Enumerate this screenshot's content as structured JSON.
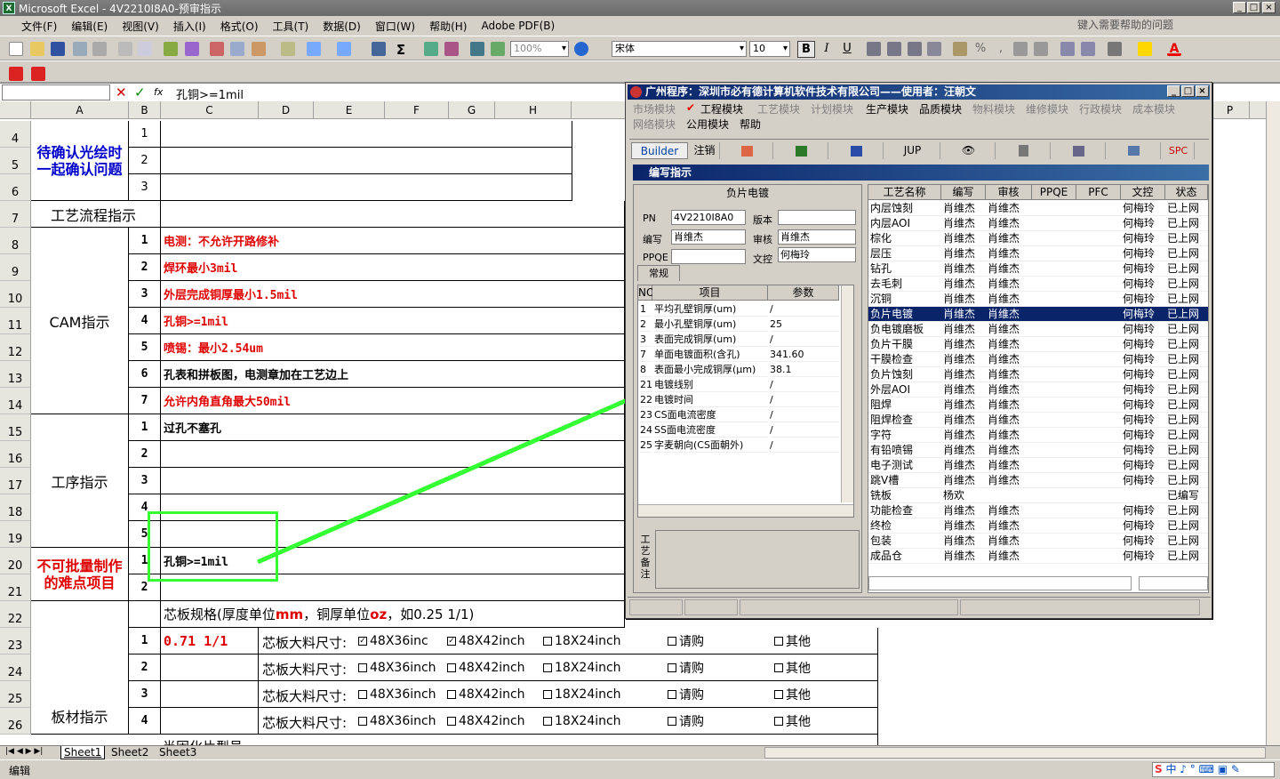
{
  "app": {
    "title": "Microsoft Excel - 4V2210I8A0-预审指示",
    "help_placeholder": "键入需要帮助的问题",
    "controls": {
      "min": "_",
      "max": "□",
      "close": "×"
    }
  },
  "menu": [
    "文件(F)",
    "编辑(E)",
    "视图(V)",
    "插入(I)",
    "格式(O)",
    "工具(T)",
    "数据(D)",
    "窗口(W)",
    "帮助(H)",
    "Adobe PDF(B)"
  ],
  "toolbar": {
    "zoom": "100%",
    "font": "宋体",
    "size": "10",
    "bold": "B",
    "italic": "I",
    "underline": "U",
    "pct": "%",
    "comma": ","
  },
  "formula": {
    "fx": "fx",
    "content": "孔铜>=1mil"
  },
  "columns": [
    "A",
    "B",
    "C",
    "D",
    "E",
    "F",
    "G",
    "H",
    "P"
  ],
  "rows": [
    "4",
    "5",
    "6",
    "7",
    "8",
    "9",
    "10",
    "11",
    "12",
    "13",
    "14",
    "15",
    "16",
    "17",
    "18",
    "19",
    "20",
    "21",
    "22",
    "23",
    "24",
    "25",
    "26"
  ],
  "sheet": {
    "confirm": "待确认光绘时一起确认问题",
    "process": "工艺流程指示",
    "cam": "CAM指示",
    "op": "工序指示",
    "hard": "不可批量制作的难点项目",
    "board": "板材指示",
    "nums": {
      "n1": "1",
      "n2": "2",
      "n3": "3",
      "n4": "4",
      "n5": "5",
      "n6": "6",
      "n7": "7"
    },
    "cam_items": [
      "电测：不允许开路修补",
      "焊环最小3mil",
      "外层完成铜厚最小1.5mil",
      "孔铜>=1mil",
      "喷锡：最小2.54um",
      "孔表和拼板图，电测章加在工艺边上",
      "允许内角直角最大50mil"
    ],
    "op1": "过孔不塞孔",
    "hard1": "孔铜>=1mil",
    "core_title_a": "芯板规格(厚度单位",
    "core_title_mm": "mm",
    "core_title_b": "，铜厚单位",
    "core_title_oz": "oz",
    "core_title_c": "，如0.25 1/1)",
    "core_val": "0.71 1/1",
    "core_size": "芯板大料尺寸:",
    "opts": [
      "48X36inch",
      "48X42inch",
      "18X24inch",
      "请购",
      "其他"
    ],
    "opts_first": "48X36inc",
    "row27": "半固化片型号"
  },
  "tabs": [
    "Sheet1",
    "Sheet2",
    "Sheet3"
  ],
  "status": "编辑",
  "popup": {
    "title": "广州程序：深圳市必有德计算机软件技术有限公司——使用者：汪朝文",
    "menu1": [
      "市场模块",
      "工程模块",
      "工艺模块",
      "计划模块",
      "生产模块",
      "品质模块",
      "物料模块",
      "维修模块",
      "行政模块",
      "成本模块"
    ],
    "menu2": [
      "网络模块",
      "公用模块",
      "帮助"
    ],
    "tools": {
      "builder": "Builder",
      "logout": "注销",
      "jup": "JUP",
      "spc": "SPC"
    },
    "subtitle": "编写指示",
    "panel": "负片电镀",
    "pn_label": "PN",
    "pn": "4V2210I8A0",
    "ver_label": "版本",
    "ver": "",
    "writer_label": "编写",
    "writer": "肖维杰",
    "checker_label": "审核",
    "checker": "肖维杰",
    "ppqe_label": "PPQE",
    "ppqe": "",
    "ctrl_label": "文控",
    "ctrl": "何梅玲",
    "tab": "常规",
    "lhdr": [
      "NO",
      "项目",
      "参数"
    ],
    "litems": [
      [
        "1",
        "平均孔壁铜厚(um)",
        "/"
      ],
      [
        "2",
        "最小孔壁铜厚(um)",
        "25"
      ],
      [
        "3",
        "表面完成铜厚(um)",
        "/"
      ],
      [
        "7",
        "单面电镀面积(含孔)",
        "341.60"
      ],
      [
        "8",
        "表面最小完成铜厚(μm)",
        "38.1"
      ],
      [
        "21",
        "电镀线别",
        "/"
      ],
      [
        "22",
        "电镀时间",
        "/"
      ],
      [
        "23",
        "CS面电流密度",
        "/"
      ],
      [
        "24",
        "SS面电流密度",
        "/"
      ],
      [
        "25",
        "字麦朝向(CS面朝外)",
        "/"
      ]
    ],
    "remark": "工艺备注",
    "rhdr": [
      "工艺名称",
      "编写",
      "审核",
      "PPQE",
      "PFC",
      "文控",
      "状态"
    ],
    "ritems": [
      [
        "内层蚀刻",
        "肖维杰",
        "肖维杰",
        "",
        "",
        "何梅玲",
        "已上网"
      ],
      [
        "内层AOI",
        "肖维杰",
        "肖维杰",
        "",
        "",
        "何梅玲",
        "已上网"
      ],
      [
        "棕化",
        "肖维杰",
        "肖维杰",
        "",
        "",
        "何梅玲",
        "已上网"
      ],
      [
        "层压",
        "肖维杰",
        "肖维杰",
        "",
        "",
        "何梅玲",
        "已上网"
      ],
      [
        "钻孔",
        "肖维杰",
        "肖维杰",
        "",
        "",
        "何梅玲",
        "已上网"
      ],
      [
        "去毛刺",
        "肖维杰",
        "肖维杰",
        "",
        "",
        "何梅玲",
        "已上网"
      ],
      [
        "沉铜",
        "肖维杰",
        "肖维杰",
        "",
        "",
        "何梅玲",
        "已上网"
      ],
      [
        "负片电镀",
        "肖维杰",
        "肖维杰",
        "",
        "",
        "何梅玲",
        "已上网"
      ],
      [
        "负电镀磨板",
        "肖维杰",
        "肖维杰",
        "",
        "",
        "何梅玲",
        "已上网"
      ],
      [
        "负片干膜",
        "肖维杰",
        "肖维杰",
        "",
        "",
        "何梅玲",
        "已上网"
      ],
      [
        "干膜检查",
        "肖维杰",
        "肖维杰",
        "",
        "",
        "何梅玲",
        "已上网"
      ],
      [
        "负片蚀刻",
        "肖维杰",
        "肖维杰",
        "",
        "",
        "何梅玲",
        "已上网"
      ],
      [
        "外层AOI",
        "肖维杰",
        "肖维杰",
        "",
        "",
        "何梅玲",
        "已上网"
      ],
      [
        "阻焊",
        "肖维杰",
        "肖维杰",
        "",
        "",
        "何梅玲",
        "已上网"
      ],
      [
        "阻焊检查",
        "肖维杰",
        "肖维杰",
        "",
        "",
        "何梅玲",
        "已上网"
      ],
      [
        "字符",
        "肖维杰",
        "肖维杰",
        "",
        "",
        "何梅玲",
        "已上网"
      ],
      [
        "有铅喷锡",
        "肖维杰",
        "肖维杰",
        "",
        "",
        "何梅玲",
        "已上网"
      ],
      [
        "电子测试",
        "肖维杰",
        "肖维杰",
        "",
        "",
        "何梅玲",
        "已上网"
      ],
      [
        "跳V槽",
        "肖维杰",
        "肖维杰",
        "",
        "",
        "何梅玲",
        "已上网"
      ],
      [
        "铣板",
        "杨欢",
        "",
        "",
        "",
        "",
        "已编写"
      ],
      [
        "功能检查",
        "肖维杰",
        "肖维杰",
        "",
        "",
        "何梅玲",
        "已上网"
      ],
      [
        "终检",
        "肖维杰",
        "肖维杰",
        "",
        "",
        "何梅玲",
        "已上网"
      ],
      [
        "包装",
        "肖维杰",
        "肖维杰",
        "",
        "",
        "何梅玲",
        "已上网"
      ],
      [
        "成品仓",
        "肖维杰",
        "肖维杰",
        "",
        "",
        "何梅玲",
        "已上网"
      ]
    ],
    "selected_row": 7
  },
  "colors": {
    "accent_red": "#e00000",
    "title_blue": "#0a246a",
    "highlight_green": "#33ff33"
  }
}
